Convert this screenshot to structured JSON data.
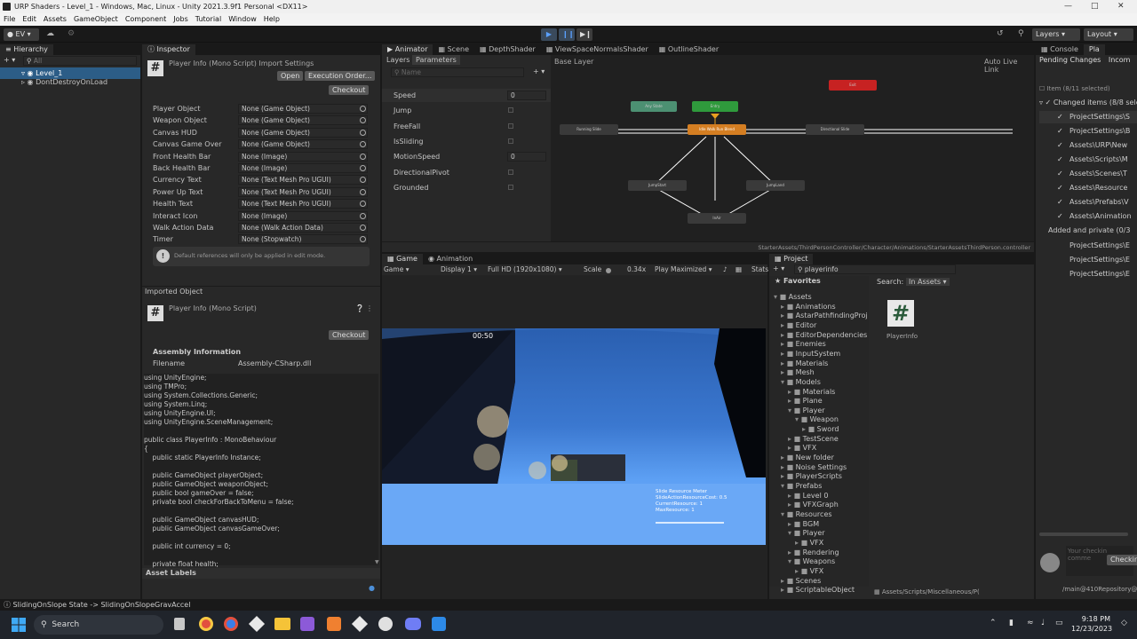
{
  "window": {
    "title": "URP Shaders - Level_1 - Windows, Mac, Linux - Unity 2021.3.9f1 Personal <DX11>"
  },
  "menu": [
    "File",
    "Edit",
    "Assets",
    "GameObject",
    "Component",
    "Jobs",
    "Tutorial",
    "Window",
    "Help"
  ],
  "toolbar": {
    "account": "EV",
    "layers": "Layers",
    "layout": "Layout"
  },
  "hierarchy": {
    "tab": "Hierarchy",
    "search_placeholder": "All",
    "items": [
      "Level_1",
      "DontDestroyOnLoad"
    ]
  },
  "inspector": {
    "tab": "Inspector",
    "title": "Player Info (Mono Script) Import Settings",
    "open": "Open",
    "exec_order": "Execution Order...",
    "checkout": "Checkout",
    "fields": [
      {
        "label": "Player Object",
        "value": "None (Game Object)"
      },
      {
        "label": "Weapon Object",
        "value": "None (Game Object)"
      },
      {
        "label": "Canvas HUD",
        "value": "None (Game Object)"
      },
      {
        "label": "Canvas Game Over",
        "value": "None (Game Object)"
      },
      {
        "label": "Front Health Bar",
        "value": "None (Image)"
      },
      {
        "label": "Back Health Bar",
        "value": "None (Image)"
      },
      {
        "label": "Currency Text",
        "value": "None (Text Mesh Pro UGUI)"
      },
      {
        "label": "Power Up Text",
        "value": "None (Text Mesh Pro UGUI)"
      },
      {
        "label": "Health Text",
        "value": "None (Text Mesh Pro UGUI)"
      },
      {
        "label": "Interact Icon",
        "value": "None (Image)"
      },
      {
        "label": "Walk Action Data",
        "value": "None (Walk Action Data)"
      },
      {
        "label": "Timer",
        "value": "None (Stopwatch)"
      }
    ],
    "help": "Default references will only be applied in edit mode.",
    "imported_object": "Imported Object",
    "imported_title": "Player Info (Mono Script)",
    "checkout2": "Checkout",
    "assembly_info": "Assembly Information",
    "filename_label": "Filename",
    "filename_value": "Assembly-CSharp.dll",
    "code": "using UnityEngine;\nusing TMPro;\nusing System.Collections.Generic;\nusing System.Linq;\nusing UnityEngine.UI;\nusing UnityEngine.SceneManagement;\n\npublic class PlayerInfo : MonoBehaviour\n{\n    public static PlayerInfo Instance;\n\n    public GameObject playerObject;\n    public GameObject weaponObject;\n    public bool gameOver = false;\n    private bool checkForBackToMenu = false;\n\n    public GameObject canvasHUD;\n    public GameObject canvasGameOver;\n\n    public int currency = 0;\n\n    private float health;",
    "asset_labels": "Asset Labels"
  },
  "animator": {
    "tabs": [
      "Animator",
      "Scene",
      "DepthShader",
      "ViewSpaceNormalsShader",
      "OutlineShader"
    ],
    "layers": "Layers",
    "parameters": "Parameters",
    "search_placeholder": "Name",
    "base_layer": "Base Layer",
    "auto_live_link": "Auto Live Link",
    "params": [
      {
        "name": "Speed",
        "value": "0"
      },
      {
        "name": "Jump",
        "value": ""
      },
      {
        "name": "FreeFall",
        "value": ""
      },
      {
        "name": "IsSliding",
        "value": ""
      },
      {
        "name": "MotionSpeed",
        "value": "0"
      },
      {
        "name": "DirectionalPivot",
        "value": ""
      },
      {
        "name": "Grounded",
        "value": ""
      }
    ],
    "nodes": [
      "Any State",
      "Entry",
      "Exit",
      "Idle Walk Run Blend",
      "Running Slide",
      "Directional Slide",
      "JumpStart",
      "InAir",
      "JumpLand"
    ],
    "path": "StarterAssets/ThirdPersonController/Character/Animations/StarterAssetsThirdPerson.controller"
  },
  "game": {
    "tabs": [
      "Game",
      "Animation"
    ],
    "mode": "Game",
    "display": "Display 1",
    "resolution": "Full HD (1920x1080)",
    "scale_label": "Scale",
    "scale_value": "0.34x",
    "play_mode": "Play Maximized",
    "stats": "Stats",
    "timer": "00:50",
    "debug": [
      "Slide Resource Meter",
      "SlideActionResourceCost: 0.5",
      "CurrentResource: 1",
      "MaxResource: 1"
    ]
  },
  "project": {
    "tab": "Project",
    "search_value": "playerinfo",
    "favorites": "Favorites",
    "search_label": "Search:",
    "in_assets": "In Assets",
    "tree": [
      "Assets",
      "Animations",
      "AstarPathfindingProj",
      "Editor",
      "EditorDependencies",
      "Enemies",
      "InputSystem",
      "Materials",
      "Mesh",
      "Models",
      "Materials",
      "Plane",
      "Player",
      "Weapon",
      "Sword",
      "TestScene",
      "VFX",
      "New folder",
      "Noise Settings",
      "PlayerScripts",
      "Prefabs",
      "Level 0",
      "VFXGraph",
      "Resources",
      "BGM",
      "Player",
      "VFX",
      "Rendering",
      "Weapons",
      "VFX",
      "Scenes",
      "ScriptableObject"
    ],
    "result": "PlayerInfo",
    "footer_path": "Assets/Scripts/Miscellaneous/P(",
    "repo": "/main@410Repository@Em"
  },
  "plastic": {
    "tabs": [
      "Console",
      "Pla",
      "Incom"
    ],
    "pending": "Pending Changes",
    "item_header": "Item (8/11 selected)",
    "changed": "Changed items (8/8 sele",
    "changed_items": [
      "ProjectSettings\\S",
      "ProjectSettings\\B",
      "Assets\\URP\\New",
      "Assets\\Scripts\\M",
      "Assets\\Scenes\\T",
      "Assets\\Resource",
      "Assets\\Prefabs\\V",
      "Assets\\Animation"
    ],
    "added": "Added and private (0/3",
    "added_items": [
      "ProjectSettings\\E",
      "ProjectSettings\\E",
      "ProjectSettings\\E"
    ],
    "comment_placeholder": "Your checkin comme",
    "checkin": "Checkin"
  },
  "status": "SlidingOnSlope State -> SlidingOnSlopeGravAccel",
  "taskbar": {
    "search": "Search",
    "time": "9:18 PM",
    "date": "12/23/2023"
  }
}
